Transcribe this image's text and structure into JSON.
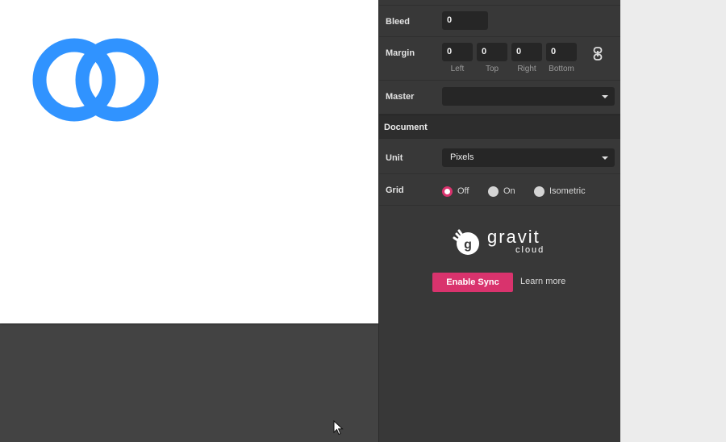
{
  "inspector": {
    "bleed": {
      "label": "Bleed",
      "value": "0"
    },
    "margin": {
      "label": "Margin",
      "fields": [
        {
          "value": "0",
          "label": "Left"
        },
        {
          "value": "0",
          "label": "Top"
        },
        {
          "value": "0",
          "label": "Right"
        },
        {
          "value": "0",
          "label": "Bottom"
        }
      ],
      "link_icon": "chain-link-icon"
    },
    "master": {
      "label": "Master",
      "value": ""
    },
    "document_section": {
      "title": "Document"
    },
    "unit": {
      "label": "Unit",
      "value": "Pixels"
    },
    "grid": {
      "label": "Grid",
      "options": [
        "Off",
        "On",
        "Isometric"
      ],
      "selected": "Off"
    },
    "cloud": {
      "brand_name": "gravit",
      "brand_sub": "cloud",
      "enable_sync_label": "Enable Sync",
      "learn_more_label": "Learn more"
    }
  },
  "canvas": {
    "shape_icon": "interlocking-rings-icon",
    "cursor_icon": "mouse-pointer-icon"
  },
  "colors": {
    "accent": "#d9336d",
    "ring_blue": "#3093ff",
    "panel_bg": "#383838",
    "field_bg": "#262626",
    "canvas_bg": "#434343"
  }
}
